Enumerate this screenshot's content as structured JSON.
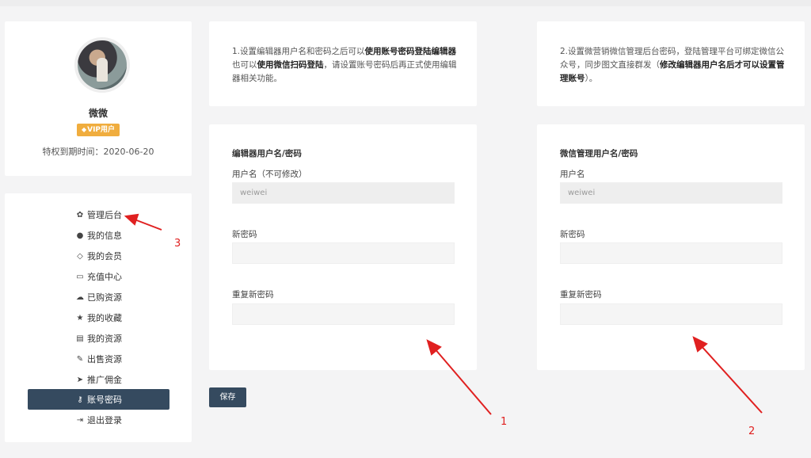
{
  "profile": {
    "username": "微微",
    "vip_badge": "VIP用户",
    "expire_text": "特权到期时间：2020-06-20"
  },
  "menu": {
    "items": [
      {
        "label": "管理后台",
        "icon": "wechat-icon",
        "glyph": "✿"
      },
      {
        "label": "我的信息",
        "icon": "user-icon",
        "glyph": "●"
      },
      {
        "label": "我的会员",
        "icon": "diamond-icon",
        "glyph": "◇"
      },
      {
        "label": "充值中心",
        "icon": "credit-card-icon",
        "glyph": "▭"
      },
      {
        "label": "已购资源",
        "icon": "cloud-download-icon",
        "glyph": "☁"
      },
      {
        "label": "我的收藏",
        "icon": "star-icon",
        "glyph": "★"
      },
      {
        "label": "我的资源",
        "icon": "file-icon",
        "glyph": "▤"
      },
      {
        "label": "出售资源",
        "icon": "pencil-icon",
        "glyph": "✎"
      },
      {
        "label": "推广佣金",
        "icon": "paper-plane-icon",
        "glyph": "➤"
      },
      {
        "label": "账号密码",
        "icon": "key-icon",
        "glyph": "⚷"
      },
      {
        "label": "退出登录",
        "icon": "sign-out-icon",
        "glyph": "⇥"
      }
    ],
    "active_index": 9
  },
  "info1": {
    "p1": "1.设置编辑器用户名和密码之后可以",
    "b1": "使用账号密码登陆编辑器",
    "p2": "也可以",
    "b2": "使用微信扫码登陆",
    "p3": "，请设置账号密码后再正式使用编辑器相关功能。"
  },
  "info2": {
    "p1": "2.设置微营销微信管理后台密码，登陆管理平台可绑定微信公众号，同步图文直接群发（",
    "b1": "修改编辑器用户名后才可以设置管理账号",
    "p2": "）。"
  },
  "form_editor": {
    "title": "编辑器用户名/密码",
    "username_label": "用户名（不可修改）",
    "username_value": "weiwei",
    "new_password_label": "新密码",
    "repeat_password_label": "重复新密码"
  },
  "form_wechat": {
    "title": "微信管理用户名/密码",
    "username_label": "用户名",
    "username_value": "weiwei",
    "new_password_label": "新密码",
    "repeat_password_label": "重复新密码"
  },
  "save_label": "保存",
  "annotations": [
    "1",
    "2",
    "3"
  ],
  "colors": {
    "accent": "#354a5f",
    "vip": "#f0ad3e",
    "annotation": "#e02020"
  }
}
